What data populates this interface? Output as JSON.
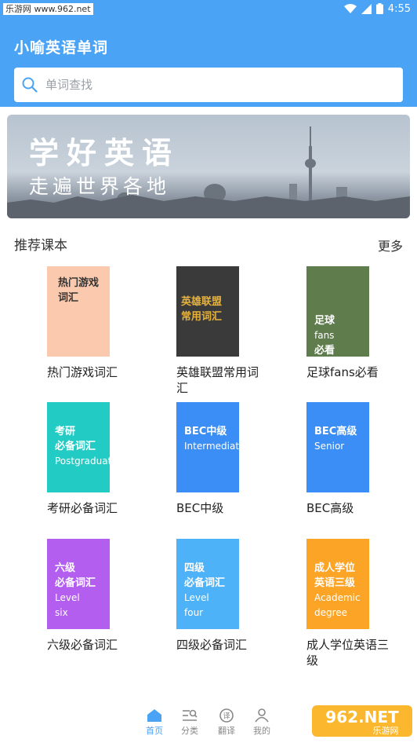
{
  "status": {
    "site": "乐游网 www.962.net",
    "time": "4:55"
  },
  "header": {
    "title": "小喻英语单词",
    "search_placeholder": "单词查找"
  },
  "banner": {
    "line1": "学好英语",
    "line2": "走遍世界各地"
  },
  "section": {
    "title": "推荐课本",
    "more": "更多"
  },
  "books": [
    {
      "label": "热门游戏词汇",
      "cover_lines": [
        "热门游戏",
        "词汇"
      ],
      "cover_color": "#fbc9ad"
    },
    {
      "label": "英雄联盟常用词汇",
      "cover_lines": [
        "英雄联盟",
        "常用词汇"
      ],
      "cover_color": "#3a3a3a"
    },
    {
      "label": "足球fans必看",
      "cover_lines": [
        "足球",
        "fans",
        "必看"
      ],
      "cover_color": "#5f7d4c"
    },
    {
      "label": "考研必备词汇",
      "cover_lines": [
        "考研",
        "必备词汇",
        "Postgraduate"
      ],
      "cover_color": "#22ccc4"
    },
    {
      "label": "BEC中级",
      "cover_lines": [
        "BEC中级",
        "Intermediate"
      ],
      "cover_color": "#3b8ef5"
    },
    {
      "label": "BEC高级",
      "cover_lines": [
        "BEC高级",
        "Senior"
      ],
      "cover_color": "#3b8ef5"
    },
    {
      "label": "六级必备词汇",
      "cover_lines": [
        "六级",
        "必备词汇",
        "Level",
        "six"
      ],
      "cover_color": "#b45ef0"
    },
    {
      "label": "四级必备词汇",
      "cover_lines": [
        "四级",
        "必备词汇",
        "Level",
        "four"
      ],
      "cover_color": "#4db2f7"
    },
    {
      "label": "成人学位英语三级",
      "cover_lines": [
        "成人学位",
        "英语三级",
        "Academic",
        "degree"
      ],
      "cover_color": "#fba425"
    }
  ],
  "tabs": [
    {
      "label": "首页",
      "icon": "home-icon",
      "active": true
    },
    {
      "label": "分类",
      "icon": "category-icon",
      "active": false
    },
    {
      "label": "翻译",
      "icon": "translate-icon",
      "active": false
    },
    {
      "label": "我的",
      "icon": "profile-icon",
      "active": false
    }
  ],
  "watermark": {
    "text": "962.NET",
    "sub": "乐游网"
  },
  "colors": {
    "primary": "#4aa3f5"
  }
}
